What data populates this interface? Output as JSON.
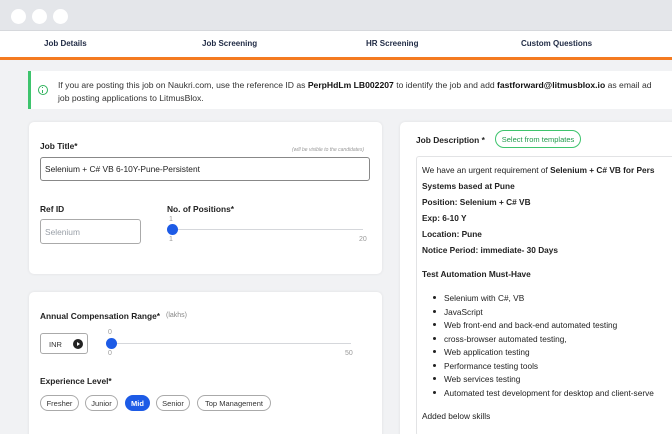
{
  "tabs": [
    {
      "label": "Job Details"
    },
    {
      "label": "Job Screening"
    },
    {
      "label": "HR Screening"
    },
    {
      "label": "Custom Questions"
    }
  ],
  "notice": {
    "text_1": "If you are posting this job on Naukri.com, use the reference ID as ",
    "ref_id": "PerpHdLm LB002207",
    "text_2": " to identify the job and add ",
    "email": "fastforward@litmusblox.io",
    "text_3": " as email ad",
    "text_4": "job posting applications to LitmusBlox."
  },
  "job": {
    "title_label": "Job Title*",
    "title_hint": "(will be visible to the candidates)",
    "title_value": "Selenium + C# VB 6-10Y-Pune-Persistent",
    "ref_label": "Ref ID",
    "ref_placeholder": "Selenium",
    "positions_label": "No. of Positions*",
    "positions_value": "1",
    "positions_min": "1",
    "positions_max": "20"
  },
  "compensation": {
    "label": "Annual Compensation Range*",
    "unit": "(lakhs)",
    "currency": "INR",
    "value": "0",
    "min": "0",
    "max": "50"
  },
  "experience": {
    "label": "Experience Level*",
    "options": [
      "Fresher",
      "Junior",
      "Mid",
      "Senior",
      "Top Management"
    ],
    "selected": "Mid"
  },
  "description": {
    "label": "Job Description *",
    "template_button": "Select from templates",
    "intro_1": "We have an urgent requirement of ",
    "intro_bold": "Selenium + C# VB   for Pers",
    "line_systems": "Systems based at Pune",
    "line_position": "Position: Selenium + C# VB",
    "line_exp": "Exp: 6-10 Y",
    "line_location": "Location: Pune",
    "line_notice": "Notice Period: immediate- 30 Days",
    "must_have_heading": "Test Automation Must-Have",
    "bullets": [
      "Selenium with C#, VB",
      "JavaScript",
      "Web front-end and back-end automated testing",
      "cross-browser automated testing,",
      "Web application testing",
      "Performance testing tools",
      "Web services testing",
      "Automated test development for desktop and client-serve"
    ],
    "footer": "Added below skills"
  },
  "colors": {
    "accent_orange": "#f47a20",
    "primary_blue": "#1d5be6",
    "success_green": "#3ec46d"
  }
}
